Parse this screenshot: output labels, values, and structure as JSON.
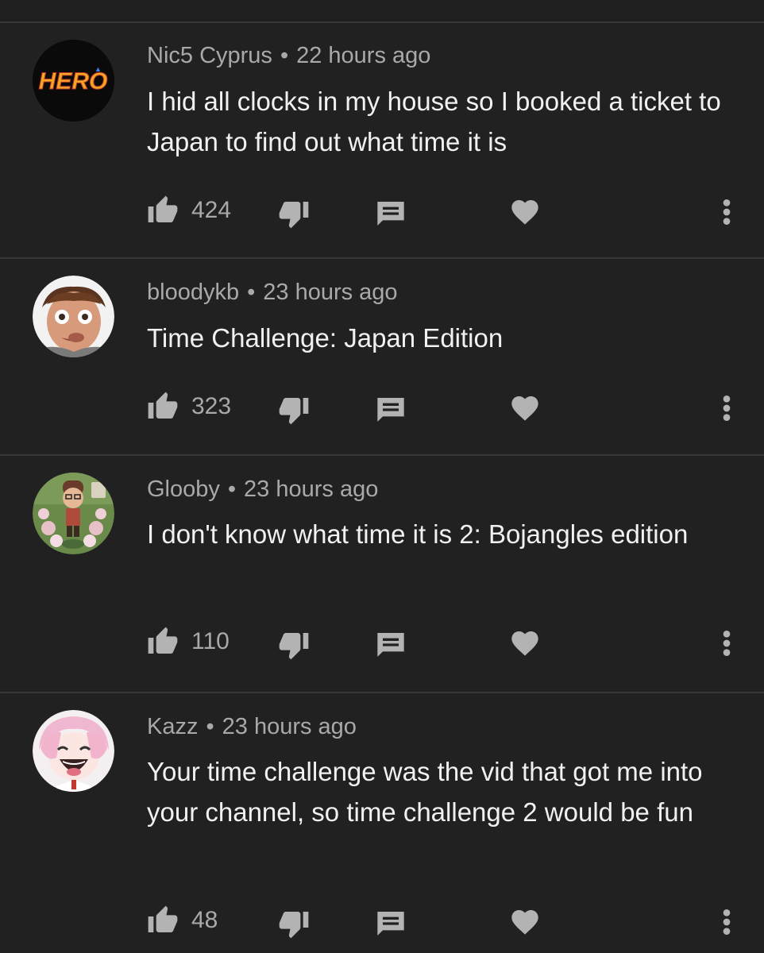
{
  "comments": [
    {
      "author": "Nic5 Cyprus",
      "time": "22 hours ago",
      "text": "I hid all clocks in my house so I booked a ticket to Japan to find out what time it is",
      "likes": "424",
      "avatar": "hero-logo-avatar",
      "avatar_text": "HERO"
    },
    {
      "author": "bloodykb",
      "time": "23 hours ago",
      "text": "Time Challenge: Japan Edition",
      "likes": "323",
      "avatar": "face-photo-avatar"
    },
    {
      "author": "Glooby",
      "time": "23 hours ago",
      "text": "I don't know what time it is 2: Bojangles edition",
      "likes": "110",
      "avatar": "game-character-avatar"
    },
    {
      "author": "Kazz",
      "time": "23 hours ago",
      "text": "Your time challenge was the vid that got me into your channel, so time challenge 2 would be fun",
      "likes": "48",
      "avatar": "anime-girl-avatar"
    }
  ],
  "icons": {
    "like": "thumbs-up-icon",
    "dislike": "thumbs-down-icon",
    "reply": "reply-icon",
    "heart": "heart-icon",
    "more": "more-vertical-icon"
  },
  "colors": {
    "background": "#212121",
    "divider": "#373737",
    "primary_text": "#f1f1f1",
    "secondary_text": "#a9a9a9",
    "icon": "#b3b3b3"
  }
}
